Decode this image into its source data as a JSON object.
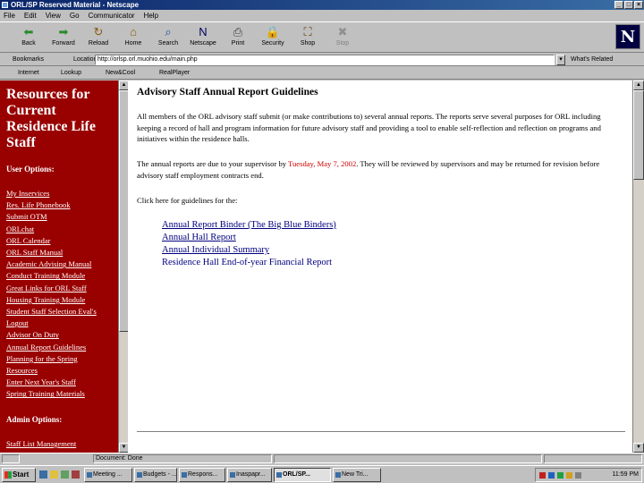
{
  "window": {
    "title": "ORL/SP Reserved Material - Netscape",
    "controls": [
      "_",
      "□",
      "×"
    ]
  },
  "menu": [
    "File",
    "Edit",
    "View",
    "Go",
    "Communicator",
    "Help"
  ],
  "toolbar": [
    {
      "label": "Back",
      "icon": "back-arrow-icon",
      "glyph": "⬅",
      "color": "#2a8a2a"
    },
    {
      "label": "Forward",
      "icon": "forward-arrow-icon",
      "glyph": "➡",
      "color": "#2a8a2a"
    },
    {
      "label": "Reload",
      "icon": "reload-icon",
      "glyph": "↻",
      "color": "#8a5a10"
    },
    {
      "label": "Home",
      "icon": "home-icon",
      "glyph": "⌂",
      "color": "#8a5a10"
    },
    {
      "label": "Search",
      "icon": "search-icon",
      "glyph": "⌕",
      "color": "#2050a0"
    },
    {
      "label": "Netscape",
      "icon": "netscape-icon",
      "glyph": "N",
      "color": "#000060"
    },
    {
      "label": "Print",
      "icon": "print-icon",
      "glyph": "⎙",
      "color": "#404040"
    },
    {
      "label": "Security",
      "icon": "lock-icon",
      "glyph": "🔒",
      "color": "#806000"
    },
    {
      "label": "Shop",
      "icon": "shop-icon",
      "glyph": "⛶",
      "color": "#604000"
    },
    {
      "label": "Stop",
      "icon": "stop-icon",
      "glyph": "✖",
      "color": "#909090"
    }
  ],
  "location": {
    "bookmarks_label": "Bookmarks",
    "location_label": "Location:",
    "url": "http://orlsp.orl.muohio.edu/main.php",
    "related_label": "What's Related"
  },
  "personal_toolbar": [
    "Internet",
    "Lookup",
    "New&Cool",
    "RealPlayer"
  ],
  "sidebar": {
    "heading": "Resources for Current Residence Life Staff",
    "user_options_label": "User Options:",
    "links": [
      "My Inservices",
      "Res. Life Phonebook",
      "Submit OTM",
      "ORLchat",
      "ORL Calendar",
      "ORL Staff Manual",
      "Academic Advising Manual",
      "Conduct Training Module",
      "Great Links for ORL Staff",
      "Housing Training Module",
      "Student Staff Selection Eval's",
      "Logout",
      "Advisor On Duty",
      "Annual Report Guidelines",
      "Planning for the Spring",
      "Resources",
      "Enter Next Year's Staff",
      "Spring Training Materials"
    ],
    "admin_options_label": "Admin Options:",
    "admin_links": [
      "Staff List Management"
    ]
  },
  "main": {
    "title": "Advisory Staff Annual Report Guidelines",
    "intro": "All members of the ORL advisory staff submit (or make contributions to) several annual reports.  The reports serve several purposes for ORL including keeping a record of hall and program information for future advisory staff and providing a tool to enable self-reflection and reflection on programs and initiatives within the residence halls.",
    "due_before": "The annual reports are due to your supervisor by ",
    "due_date": "Tuesday, May 7, 2002",
    "due_after": ".  They will be reviewed by supervisors and may be returned for revision before advisory staff employment contracts end.",
    "click_here": "Click here for guidelines for the:",
    "reports": [
      "Annual Report Binder (The Big Blue Binders)",
      "Annual Hall Report",
      "Annual Individual Summary",
      "Residence Hall End-of-year Financial Report"
    ]
  },
  "status": {
    "text": "Document: Done"
  },
  "taskbar": {
    "start_label": "Start",
    "tasks": [
      "Meeting ...",
      "Budgets - ...",
      "Respons...",
      "Inaspapr...",
      "ORL/SP...",
      "New Tri..."
    ],
    "active_index": 4,
    "clock": "11:59 PM"
  }
}
